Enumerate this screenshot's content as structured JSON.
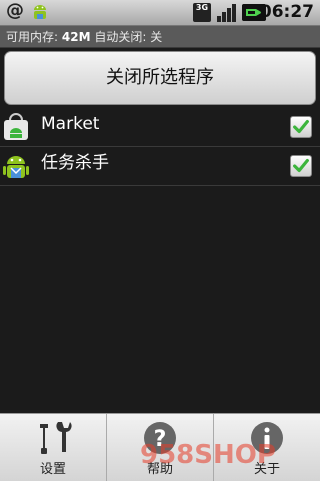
{
  "status_bar": {
    "notification_icon_1": "at-sign-icon",
    "notification_icon_2": "android-icon",
    "network_label": "3G",
    "time": "06:27"
  },
  "info_bar": {
    "memory_label": "可用内存:",
    "memory_value": "42M",
    "auto_close_label": "自动关闭:",
    "auto_close_value": "关"
  },
  "main": {
    "close_selected_button": "关闭所选程序"
  },
  "apps": [
    {
      "name": "Market",
      "icon": "market-bag-icon",
      "checked": true
    },
    {
      "name": "任务杀手",
      "icon": "android-icon",
      "checked": true
    }
  ],
  "tabs": [
    {
      "label": "设置",
      "icon": "tools-icon"
    },
    {
      "label": "帮助",
      "icon": "question-icon"
    },
    {
      "label": "关于",
      "icon": "info-icon"
    }
  ],
  "watermark": "958SHOP",
  "colors": {
    "accent_check": "#3cb53c",
    "background": "#1b1b1b",
    "info_bar": "#5a5a5a"
  }
}
